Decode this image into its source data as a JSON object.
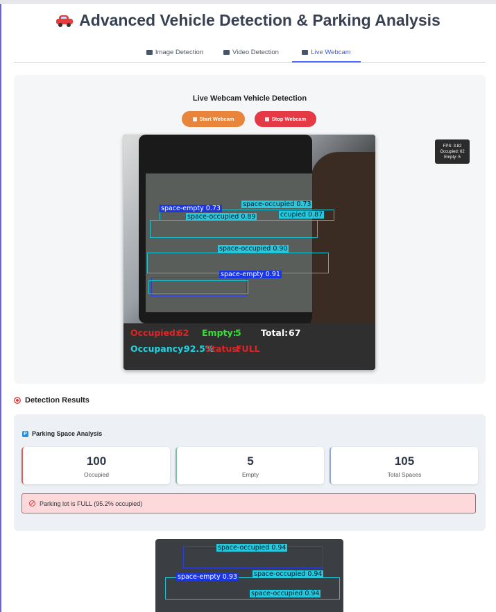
{
  "header": {
    "icon": "car-icon",
    "title": "Advanced Vehicle Detection & Parking Analysis"
  },
  "tabs": [
    {
      "label": "Image Detection",
      "icon": "image-icon",
      "active": false
    },
    {
      "label": "Video Detection",
      "icon": "video-icon",
      "active": false
    },
    {
      "label": "Live Webcam",
      "icon": "webcam-icon",
      "active": true
    }
  ],
  "webcam": {
    "heading": "Live Webcam Vehicle Detection",
    "start_label": "Start Webcam",
    "stop_label": "Stop Webcam",
    "start_color": "#e8853a",
    "stop_color": "#e53945",
    "detections": [
      "space-empty 0.73",
      "space-occupied 0.73",
      "space-occupied 0.89",
      "ccupied 0.87",
      "space-occupied 0.90",
      "space-empty 0.91"
    ],
    "overlay": {
      "occupied_label": "Occupied:",
      "occupied_value": "62",
      "empty_label": "Empty:",
      "empty_value": "5",
      "total_label": "Total:",
      "total_value": "67",
      "occupancy_label": "Occupancy:",
      "occupancy_value": "92.5%",
      "status_label": "Status:",
      "status_value": "FULL"
    }
  },
  "fps_badge": {
    "fps": "FPS: 3.82",
    "occupied": "Occupied: 62",
    "empty": "Empty: 5"
  },
  "results": {
    "heading": "Detection Results",
    "section_title": "Parking Space Analysis",
    "cards": [
      {
        "value": "100",
        "caption": "Occupied"
      },
      {
        "value": "5",
        "caption": "Empty"
      },
      {
        "value": "105",
        "caption": "Total Spaces"
      }
    ],
    "alert": "Parking lot is FULL (95.2% occupied)",
    "image_detections": [
      "space-occupied 0.94",
      "space-empty 0.93",
      "space-occupied 0.94",
      "space-occupied 0.94"
    ]
  }
}
